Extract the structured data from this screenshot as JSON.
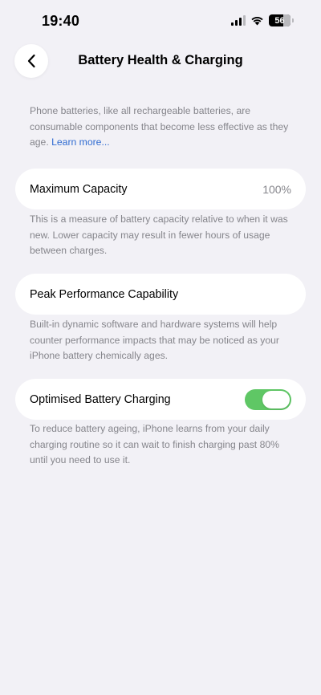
{
  "status_bar": {
    "time": "19:40",
    "battery_level": "56",
    "icons": [
      "cellular-signal-icon",
      "wifi-icon",
      "battery-icon"
    ]
  },
  "nav": {
    "back_icon": "chevron-left-icon",
    "title": "Battery Health & Charging"
  },
  "intro": {
    "text": "Phone batteries, like all rechargeable batteries, are consumable components that become less effective as they age.",
    "link": "Learn more..."
  },
  "maximum_capacity": {
    "label": "Maximum Capacity",
    "value": "100%",
    "footer": "This is a measure of battery capacity relative to when it was new. Lower capacity may result in fewer hours of usage between charges."
  },
  "peak_performance": {
    "label": "Peak Performance Capability",
    "footer": "Built-in dynamic software and hardware systems will help counter performance impacts that may be noticed as your iPhone battery chemically ages."
  },
  "optimised_charging": {
    "label": "Optimised Battery Charging",
    "enabled": true,
    "footer": "To reduce battery ageing, iPhone learns from your daily charging routine so it can wait to finish charging past 80% until you need to use it."
  },
  "colors": {
    "background": "#f2f1f6",
    "card": "#ffffff",
    "secondary_text": "#85858b",
    "link": "#2f6bd1",
    "toggle_on": "#5fc765"
  }
}
